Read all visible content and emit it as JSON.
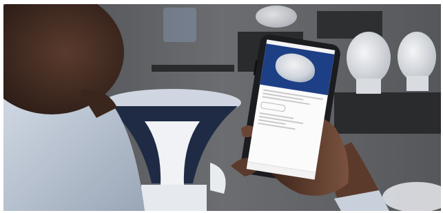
{
  "image": {
    "kind": "photo",
    "colors": {
      "wall": "#5f6163",
      "shelf": "#2a2b2d",
      "porcelain": "#e9ecef",
      "shirt": "#c9d2df",
      "skin": "#6b4736",
      "phone_body": "#1b1c1f",
      "screen_hero": "#1d3f86",
      "screen_title": "#2a63c9"
    }
  }
}
